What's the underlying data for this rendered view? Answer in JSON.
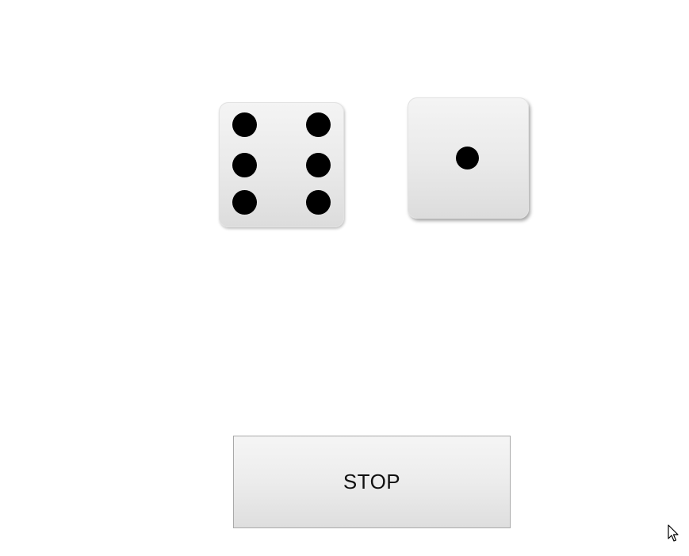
{
  "dice": [
    {
      "name": "left-die",
      "value": 6
    },
    {
      "name": "right-die",
      "value": 1
    }
  ],
  "controls": {
    "stop_label": "STOP"
  },
  "colors": {
    "background": "#ffffff",
    "die_face": "#ebebeb",
    "pip": "#000000",
    "button_face": "#ececec",
    "button_border": "#a9a9a9"
  },
  "icons": {
    "cursor": "mouse-pointer-icon"
  }
}
